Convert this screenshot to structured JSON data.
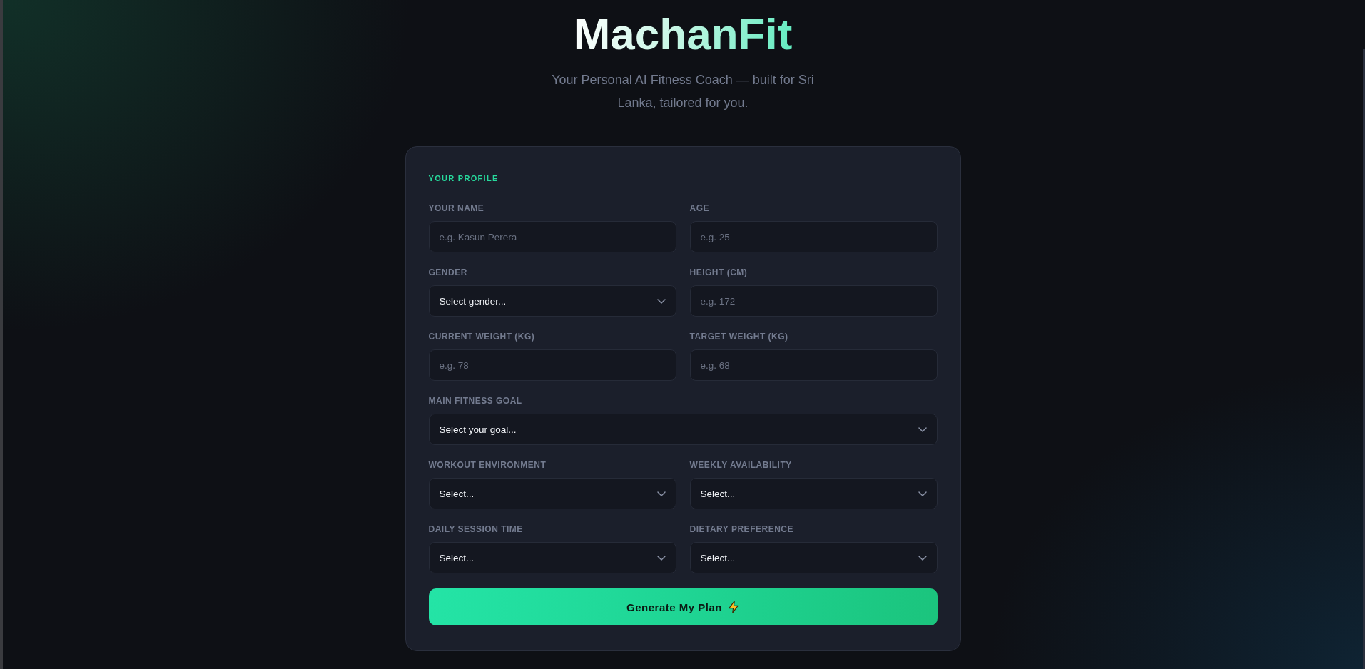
{
  "header": {
    "title": "MachanFit",
    "subtitle": "Your Personal AI Fitness Coach — built for Sri Lanka, tailored for you."
  },
  "profile_card": {
    "heading": "YOUR PROFILE",
    "rows": [
      [
        {
          "kind": "input",
          "label": "YOUR NAME",
          "placeholder": "e.g. Kasun Perera"
        },
        {
          "kind": "input",
          "label": "AGE",
          "placeholder": "e.g. 25"
        }
      ],
      [
        {
          "kind": "select",
          "label": "GENDER",
          "value": "Select gender..."
        },
        {
          "kind": "input",
          "label": "HEIGHT (CM)",
          "placeholder": "e.g. 172"
        }
      ],
      [
        {
          "kind": "input",
          "label": "CURRENT WEIGHT (KG)",
          "placeholder": "e.g. 78"
        },
        {
          "kind": "input",
          "label": "TARGET WEIGHT (KG)",
          "placeholder": "e.g. 68"
        }
      ],
      [
        {
          "kind": "select",
          "label": "MAIN FITNESS GOAL",
          "value": "Select your goal..."
        }
      ],
      [
        {
          "kind": "select",
          "label": "WORKOUT ENVIRONMENT",
          "value": "Select..."
        },
        {
          "kind": "select",
          "label": "WEEKLY AVAILABILITY",
          "value": "Select..."
        }
      ],
      [
        {
          "kind": "select",
          "label": "DAILY SESSION TIME",
          "value": "Select..."
        },
        {
          "kind": "select",
          "label": "DIETARY PREFERENCE",
          "value": "Select..."
        }
      ]
    ],
    "submit_button": {
      "label": "Generate My Plan"
    }
  }
}
